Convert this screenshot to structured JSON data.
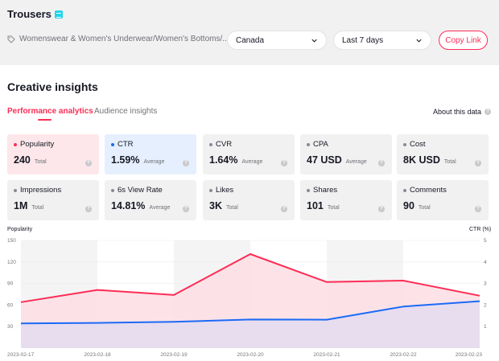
{
  "header": {
    "title": "Trousers",
    "breadcrumb": "Womenswear & Women's Underwear/Women's Bottoms/...",
    "country": "Canada",
    "range": "Last 7 days",
    "copy_label": "Copy Link"
  },
  "section": {
    "title": "Creative insights",
    "tabs": [
      {
        "label": "Performance analytics",
        "active": true
      },
      {
        "label": "Audience insights",
        "active": false
      }
    ],
    "about": "About this data"
  },
  "metrics": [
    {
      "label": "Popularity",
      "value": "240",
      "sub": "Total",
      "dot": "#fe2c55"
    },
    {
      "label": "CTR",
      "value": "1.59%",
      "sub": "Average",
      "dot": "#1c6af5"
    },
    {
      "label": "CVR",
      "value": "1.64%",
      "sub": "Average",
      "dot": "#8a8b91"
    },
    {
      "label": "CPA",
      "value": "47 USD",
      "sub": "Average",
      "dot": "#8a8b91"
    },
    {
      "label": "Cost",
      "value": "8K USD",
      "sub": "Total",
      "dot": "#8a8b91"
    },
    {
      "label": "Impressions",
      "value": "1M",
      "sub": "Total",
      "dot": "#8a8b91"
    },
    {
      "label": "6s View Rate",
      "value": "14.81%",
      "sub": "Average",
      "dot": "#8a8b91"
    },
    {
      "label": "Likes",
      "value": "3K",
      "sub": "Total",
      "dot": "#8a8b91"
    },
    {
      "label": "Shares",
      "value": "101",
      "sub": "Total",
      "dot": "#8a8b91"
    },
    {
      "label": "Comments",
      "value": "90",
      "sub": "Total",
      "dot": "#8a8b91"
    }
  ],
  "chart_data": {
    "type": "line",
    "x": [
      "2023-02-17",
      "2023-02-18",
      "2023-02-19",
      "2023-02-20",
      "2023-02-21",
      "2023-02-22",
      "2023-02-23"
    ],
    "left_axis_label": "Popularity",
    "right_axis_label": "CTR (%)",
    "left_ticks": [
      150,
      120,
      90,
      60,
      30
    ],
    "right_ticks": [
      5,
      4,
      3,
      2,
      1
    ],
    "ylim_left": [
      0,
      150
    ],
    "ylim_right": [
      0,
      5
    ],
    "series": [
      {
        "axis": "left",
        "color": "#fe2c55",
        "fill": "#fde0e5",
        "values": [
          64,
          81,
          74,
          131,
          92,
          94,
          73
        ]
      },
      {
        "axis": "right",
        "color": "#1c6af5",
        "fill": "#e3dcf0",
        "values": [
          1.15,
          1.17,
          1.22,
          1.33,
          1.32,
          1.93,
          2.18
        ]
      }
    ]
  },
  "colors": {
    "accent": "#fe2c55",
    "ctr": "#1c6af5"
  }
}
